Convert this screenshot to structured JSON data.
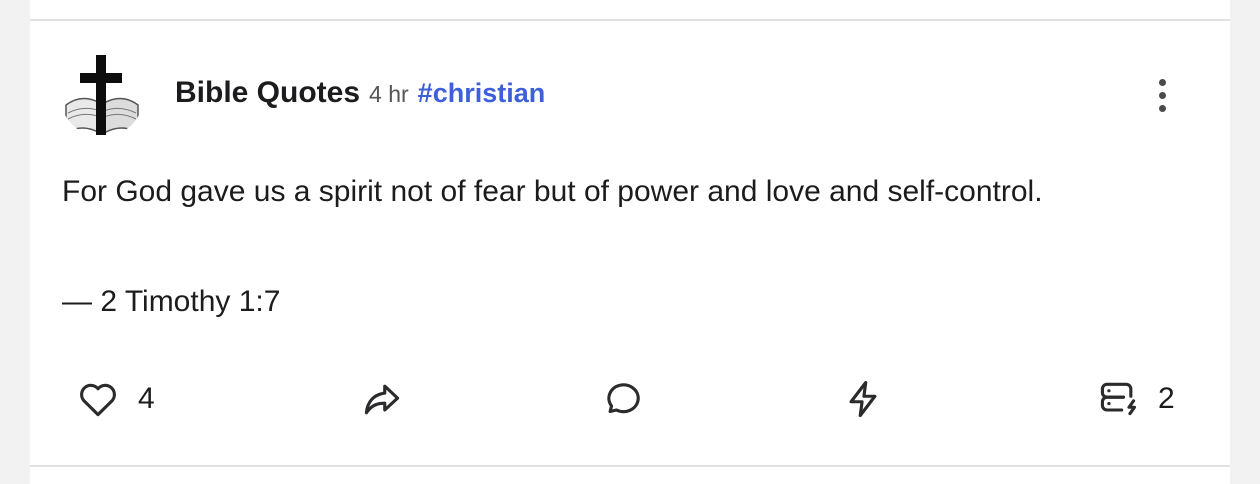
{
  "post": {
    "author": "Bible Quotes",
    "time": "4 hr",
    "tag": "#christian",
    "text": "For God gave us a spirit not of fear but of power and love and self-control.",
    "reference": "— 2 Timothy 1:7"
  },
  "actions": {
    "like_count": "4",
    "boosts_count": "2"
  },
  "icons": {
    "avatar": "cross-bible-avatar",
    "menu": "more-vertical-icon",
    "like": "heart-icon",
    "share": "share-arrow-icon",
    "comment": "comment-bubble-icon",
    "zap": "lightning-icon",
    "relays": "server-lightning-icon"
  },
  "colors": {
    "link": "#3d5fd9",
    "text": "#1c1c1e",
    "divider": "#e1e1e4"
  }
}
